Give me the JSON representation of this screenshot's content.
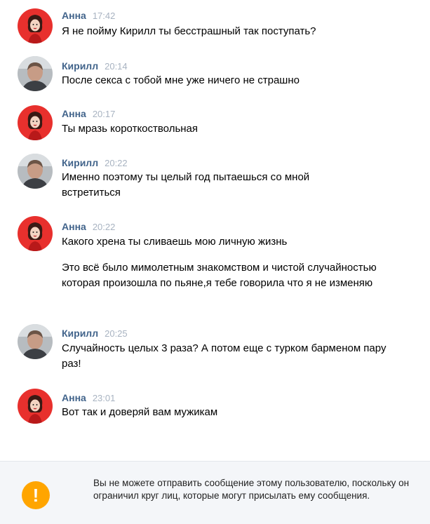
{
  "messages": [
    {
      "author": "Анна",
      "time": "17:42",
      "avatar": "anna-avatar",
      "lines": [
        "Я не пойму Кирилл ты бесстрашный так поступать?"
      ]
    },
    {
      "author": "Кирилл",
      "time": "20:14",
      "avatar": "kirill-avatar",
      "lines": [
        "После секса с тобой мне уже ничего не страшно"
      ]
    },
    {
      "author": "Анна",
      "time": "20:17",
      "avatar": "anna-avatar",
      "lines": [
        "Ты мразь короткоствольная"
      ]
    },
    {
      "author": "Кирилл",
      "time": "20:22",
      "avatar": "kirill-avatar",
      "lines": [
        "Именно поэтому ты целый год пытаешься со мной встретиться"
      ]
    },
    {
      "author": "Анна",
      "time": "20:22",
      "avatar": "anna-avatar",
      "lines": [
        "Какого хрена ты сливаешь мою личную жизнь",
        "Это всё было мимолетным знакомством и чистой случайностью которая произошла по пьяне,я тебе говорила что я не изменяю"
      ]
    },
    {
      "author": "Кирилл",
      "time": "20:25",
      "avatar": "kirill-avatar",
      "lines": [
        "Случайность целых 3 раза? А потом еще с турком барменом пару раз!"
      ]
    },
    {
      "author": "Анна",
      "time": "23:01",
      "avatar": "anna-avatar",
      "lines": [
        "Вот так и доверяй вам мужикам"
      ]
    }
  ],
  "notice": {
    "icon": "warning-icon",
    "icon_glyph": "!",
    "text": "Вы не можете отправить сообщение этому пользователю, поскольку он ограничил круг лиц, которые могут присылать ему сообщения."
  },
  "colors": {
    "author": "#42648b",
    "time": "#a8b3c1",
    "anna_avatar_bg": "#e8302d",
    "notice_bg": "#f4f6f9",
    "warning": "#ffa500"
  }
}
